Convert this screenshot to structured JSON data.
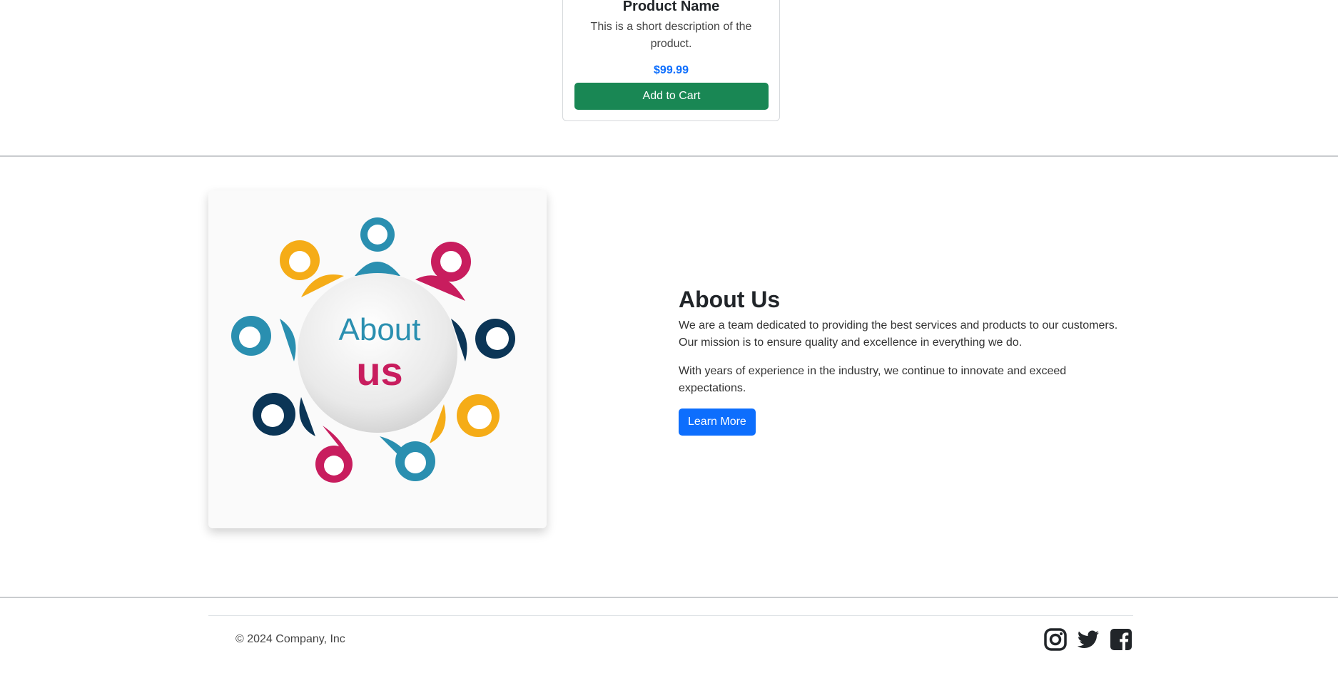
{
  "product": {
    "name": "Product Name",
    "description": "This is a short description of the product.",
    "price": "$99.99",
    "add_to_cart_label": "Add to Cart"
  },
  "about": {
    "image_text_line1": "About",
    "image_text_line2": "us",
    "title": "About Us",
    "paragraph1": "We are a team dedicated to providing the best services and products to our customers. Our mission is to ensure quality and excellence in everything we do.",
    "paragraph2": "With years of experience in the industry, we continue to innovate and exceed expectations.",
    "learn_more_label": "Learn More"
  },
  "footer": {
    "copyright": "© 2024 Company, Inc",
    "social_icons": [
      "instagram-icon",
      "twitter-icon",
      "facebook-icon"
    ]
  },
  "colors": {
    "success": "#198754",
    "primary": "#0d6efd",
    "teal": "#2a8fb0",
    "magenta": "#c81d5e",
    "navy": "#0b3556",
    "amber": "#f5ac17"
  }
}
